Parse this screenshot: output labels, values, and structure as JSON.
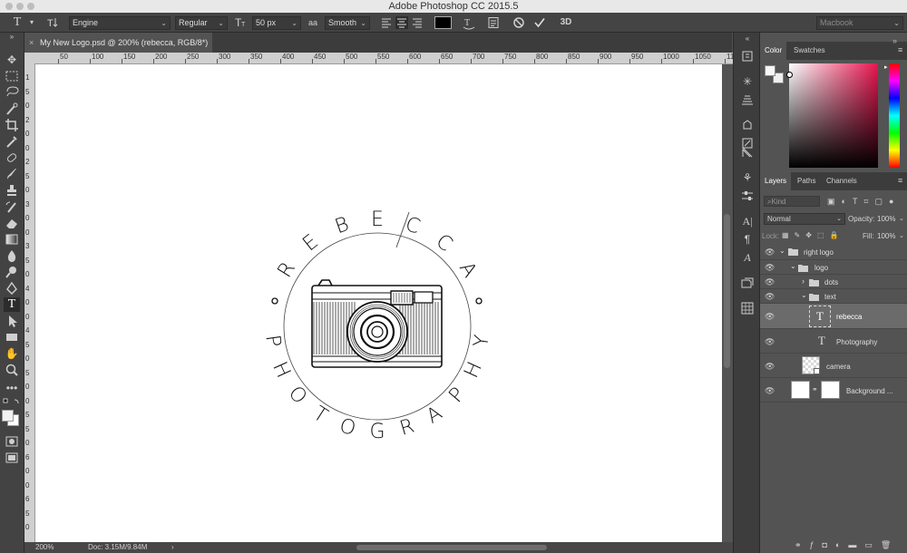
{
  "window": {
    "title": "Adobe Photoshop CC 2015.5"
  },
  "options_bar": {
    "tool_glyph": "T",
    "font_family": "Engine",
    "font_style": "Regular",
    "font_size": "50 px",
    "antialias_label": "aa",
    "antialias": "Smooth",
    "color_swatch": "#000000",
    "threed_label": "3D",
    "workspace": "Macbook"
  },
  "document": {
    "tab_label": "My New Logo.psd @ 200% (rebecca, RGB/8*) *",
    "zoom": "200%",
    "doc_size": "Doc: 3.15M/9.84M"
  },
  "ruler": {
    "h_ticks": [
      "50",
      "100",
      "150",
      "200",
      "250",
      "300",
      "350",
      "400",
      "450",
      "500",
      "550",
      "600",
      "650",
      "700",
      "750",
      "800",
      "850",
      "900",
      "950",
      "1000",
      "1050",
      "1100"
    ],
    "v_ticks": [
      "1",
      "5",
      "0",
      "2",
      "0",
      "0",
      "2",
      "5",
      "0",
      "3",
      "0",
      "0",
      "3",
      "5",
      "0",
      "4",
      "0",
      "0",
      "4",
      "5",
      "0",
      "5",
      "0",
      "0",
      "5",
      "5",
      "0",
      "6",
      "0",
      "0",
      "6",
      "5",
      "0"
    ]
  },
  "logo": {
    "top_letters": [
      "R",
      "E",
      "B",
      "E",
      "C",
      "C",
      "A"
    ],
    "bottom_letters": [
      "P",
      "H",
      "O",
      "T",
      "O",
      "G",
      "R",
      "A",
      "P",
      "H",
      "Y"
    ]
  },
  "color_panel": {
    "tabs": [
      "Color",
      "Swatches"
    ],
    "hue_color": "#e8154f"
  },
  "layers_panel": {
    "tabs": [
      "Layers",
      "Paths",
      "Channels"
    ],
    "filter_placeholder": "Kind",
    "blend_mode": "Normal",
    "opacity_label": "Opacity:",
    "opacity": "100%",
    "lock_label": "Lock:",
    "fill_label": "Fill:",
    "fill": "100%",
    "layers": [
      {
        "name": "right logo",
        "kind": "group"
      },
      {
        "name": "logo",
        "kind": "group"
      },
      {
        "name": "dots",
        "kind": "group"
      },
      {
        "name": "text",
        "kind": "group"
      },
      {
        "name": "rebecca",
        "kind": "text",
        "selected": true
      },
      {
        "name": "Photography",
        "kind": "text"
      },
      {
        "name": "camera",
        "kind": "smart-object"
      },
      {
        "name": "Background ...",
        "kind": "layer-with-mask"
      }
    ]
  }
}
